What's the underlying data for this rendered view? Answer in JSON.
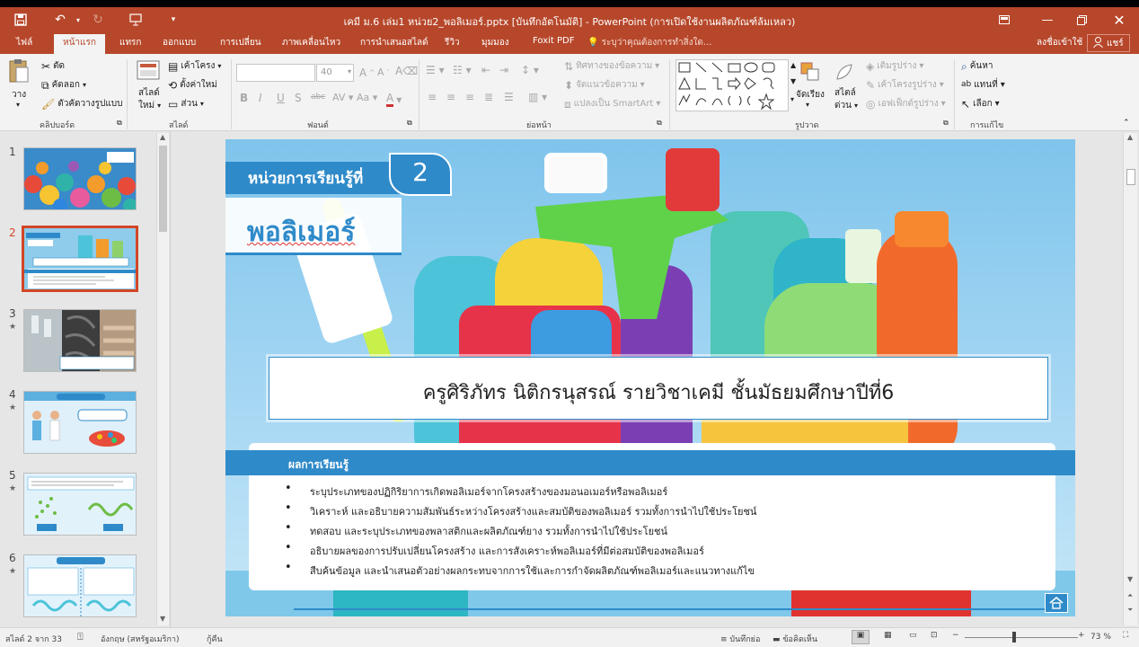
{
  "window": {
    "title": "เคมี ม.6 เล่ม1 หน่วย2_พอลิเมอร์.pptx [บันทึกอัตโนมัติ] - PowerPoint (การเปิดใช้งานผลิตภัณฑ์ล้มเหลว)"
  },
  "tabs": [
    {
      "label": "ไฟล์"
    },
    {
      "label": "หน้าแรก"
    },
    {
      "label": "แทรก"
    },
    {
      "label": "ออกแบบ"
    },
    {
      "label": "การเปลี่ยน"
    },
    {
      "label": "ภาพเคลื่อนไหว"
    },
    {
      "label": "การนำเสนอสไลด์"
    },
    {
      "label": "รีวิว"
    },
    {
      "label": "มุมมอง"
    },
    {
      "label": "Foxit PDF"
    }
  ],
  "tell_me": "ระบุว่าคุณต้องการทำสิ่งใด...",
  "account": {
    "signin": "ลงชื่อเข้าใช้",
    "share": "แชร์"
  },
  "ribbon": {
    "clipboard": {
      "paste": "วาง",
      "cut": "ตัด",
      "copy": "คัดลอก",
      "format_painter": "ตัวคัดวางรูปแบบ",
      "label": "คลิปบอร์ด"
    },
    "slides": {
      "new_slide_1": "สไลด์",
      "new_slide_2": "ใหม่",
      "layout": "เค้าโครง",
      "reset": "ตั้งค่าใหม่",
      "section": "ส่วน",
      "label": "สไลด์"
    },
    "font": {
      "size": "40",
      "bold": "B",
      "italic": "I",
      "underline": "U",
      "strike": "S",
      "shadow": "abc",
      "label": "ฟอนต์"
    },
    "paragraph": {
      "text_direction": "ทิศทางของข้อความ",
      "align_text": "จัดแนวข้อความ",
      "smartart": "แปลงเป็น SmartArt",
      "label": "ย่อหน้า"
    },
    "drawing": {
      "arrange": "จัดเรียง",
      "quick_styles_1": "สไตล์",
      "quick_styles_2": "ด่วน",
      "shape_fill": "เติมรูปร่าง",
      "shape_outline": "เค้าโครงรูปร่าง",
      "shape_effects": "เอฟเฟ็กต์รูปร่าง",
      "label": "รูปวาด"
    },
    "editing": {
      "find": "ค้นหา",
      "replace": "แทนที่",
      "select": "เลือก",
      "label": "การแก้ไข"
    }
  },
  "thumbnails": [
    {
      "number": "1",
      "star": ""
    },
    {
      "number": "2",
      "star": ""
    },
    {
      "number": "3",
      "star": "★"
    },
    {
      "number": "4",
      "star": "★"
    },
    {
      "number": "5",
      "star": "★"
    },
    {
      "number": "6",
      "star": "★"
    }
  ],
  "slide": {
    "unit_label": "หน่วยการเรียนรู้ที่",
    "unit_number": "2",
    "topic": "พอลิเมอร์",
    "teacher": "ครูศิริภัทร นิติกรนุสรณ์ รายวิชาเคมี ชั้นมัธยมศึกษาปีที่6",
    "outcomes_title": "ผลการเรียนรู้",
    "outcomes": [
      "ระบุประเภทของปฏิกิริยาการเกิดพอลิเมอร์จากโครงสร้างของมอนอเมอร์หรือพอลิเมอร์",
      "วิเคราะห์ และอธิบายความสัมพันธ์ระหว่างโครงสร้างและสมบัติของพอลิเมอร์ รวมทั้งการนำไปใช้ประโยชน์",
      "ทดสอบ และระบุประเภทของพลาสติกและผลิตภัณฑ์ยาง รวมทั้งการนำไปใช้ประโยชน์",
      "อธิบายผลของการปรับเปลี่ยนโครงสร้าง และการสังเคราะห์พอลิเมอร์ที่มีต่อสมบัติของพอลิเมอร์",
      "สืบค้นข้อมูล และนำเสนอตัวอย่างผลกระทบจากการใช้และการกำจัดผลิตภัณฑ์พอลิเมอร์และแนวทางแก้ไข"
    ]
  },
  "status": {
    "slide_of": "สไลด์ 2 จาก 33",
    "language": "อังกฤษ (สหรัฐอเมริกา)",
    "recovered": "กู้คืน",
    "notes": "บันทึกย่อ",
    "comments": "ข้อคิดเห็น",
    "zoom": "73 %"
  },
  "colors": {
    "accent": "#b7472a",
    "slide_blue": "#2f8ac9",
    "selected": "#d24726"
  }
}
